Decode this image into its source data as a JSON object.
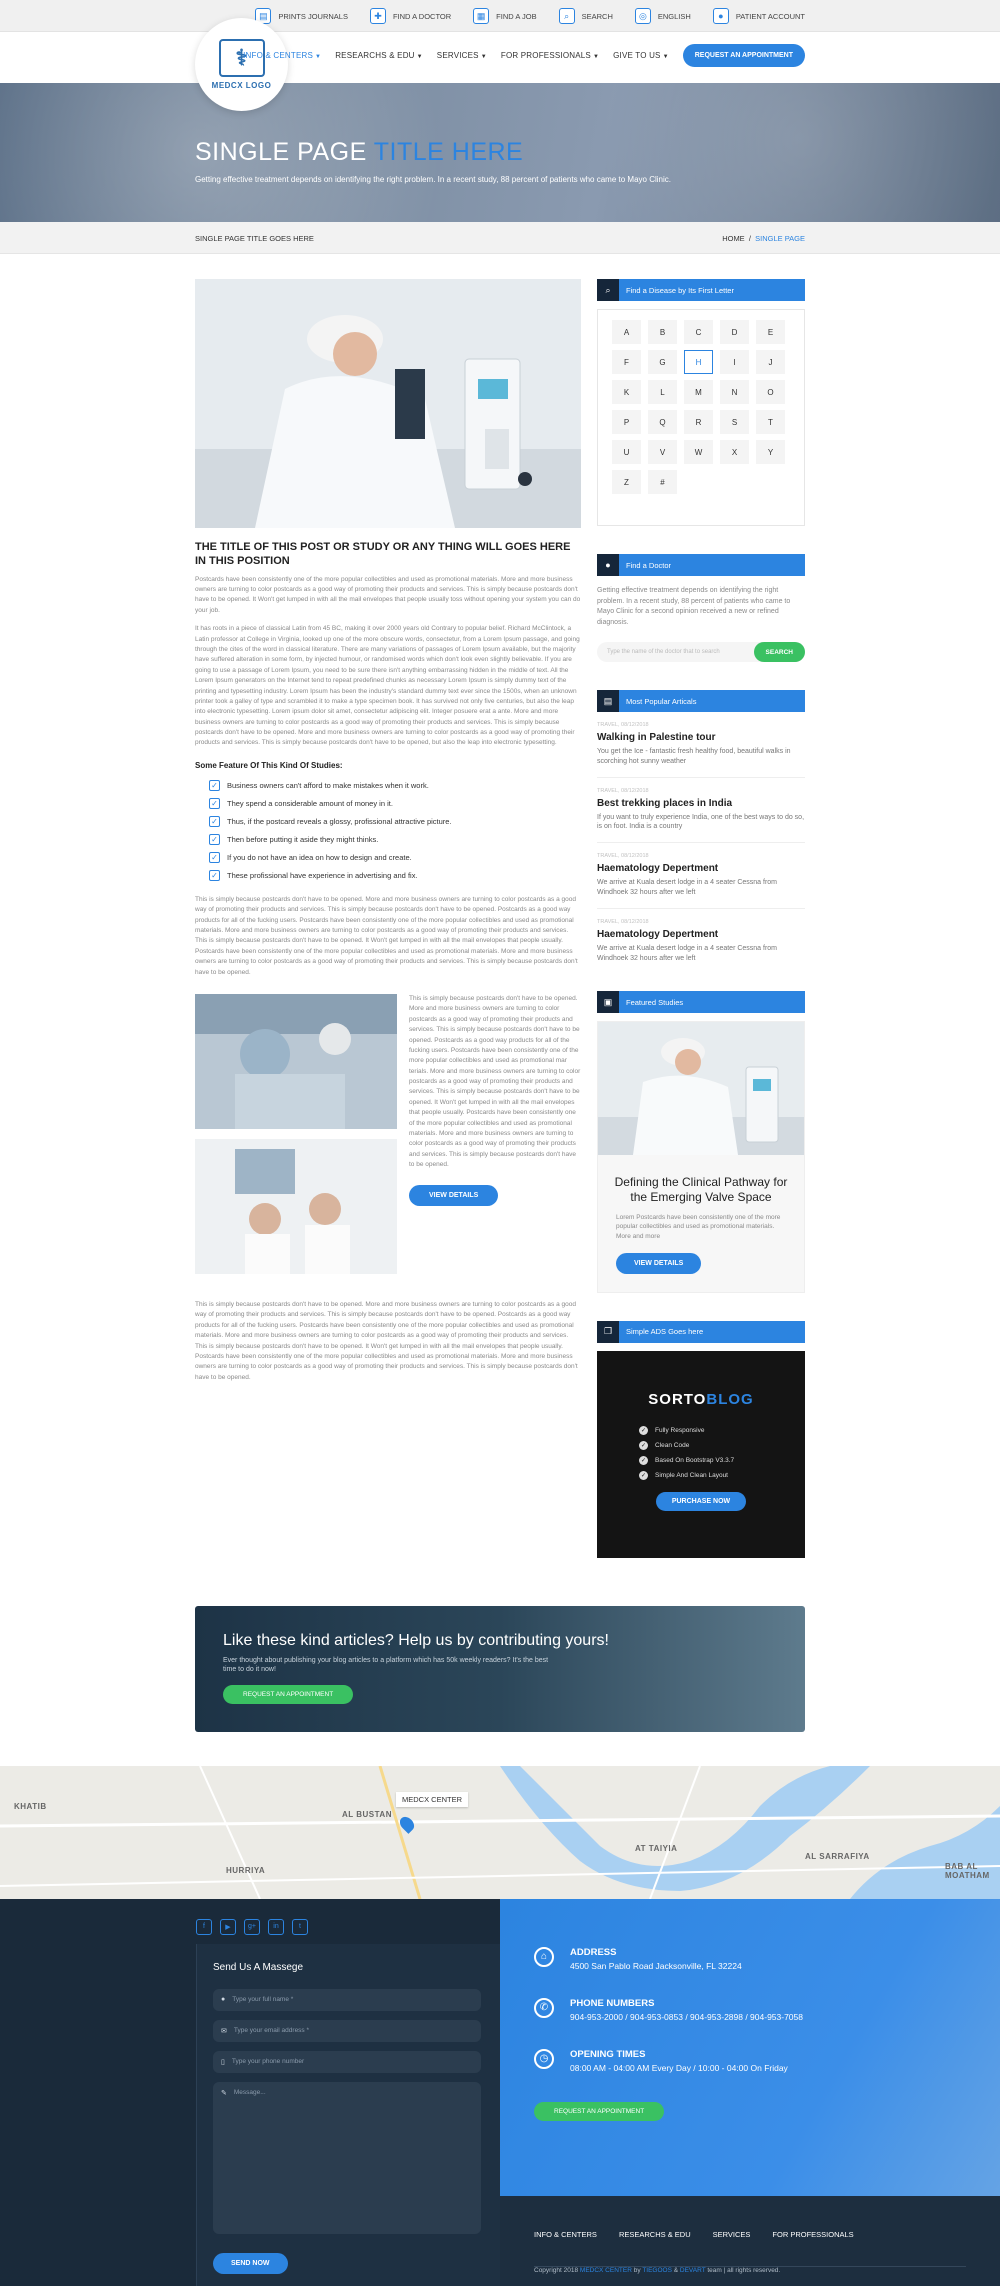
{
  "topbar": {
    "items": [
      {
        "label": "PRINTS JOURNALS",
        "icon": "journal-icon"
      },
      {
        "label": "FIND A DOCTOR",
        "icon": "doctor-icon"
      },
      {
        "label": "FIND A JOB",
        "icon": "job-icon"
      },
      {
        "label": "SEARCH",
        "icon": "search-icon"
      },
      {
        "label": "ENGLISH",
        "icon": "globe-icon"
      },
      {
        "label": "PATIENT ACCOUNT",
        "icon": "user-icon"
      }
    ]
  },
  "logo": {
    "text": "MEDCX LOGO"
  },
  "nav": {
    "items": [
      "INFO & CENTERS",
      "RESEARCHS & EDU",
      "SERVICES",
      "FOR PROFESSIONALS",
      "GIVE TO US"
    ],
    "cta": "REQUEST AN APPOINTMENT"
  },
  "hero": {
    "title_a": "SINGLE PAGE",
    "title_b": "TITLE HERE",
    "subtitle": "Getting effective treatment depends on identifying the right problem. In a recent study, 88 percent of patients who came to Mayo Clinic."
  },
  "crumb": {
    "page": "SINGLE PAGE TITLE GOES HERE",
    "home": "HOME",
    "current": "SINGLE PAGE"
  },
  "post": {
    "title": "THE TITLE OF THIS POST OR STUDY OR ANY THING WILL GOES HERE IN THIS POSITION",
    "p1": "Postcards have been consistently one of the more popular collectibles and used as promotional materials. More and more business owners are turning to color postcards as a good way of promoting their products and services. This is simply because postcards don't have to be opened. It Won't get lumped in with all the mail envelopes that people usually toss without opening your system you can do your job.",
    "p2": "It has roots in a piece of classical Latin from 45 BC, making it over 2000 years old Contrary to popular belief. Richard McClintock, a Latin professor at College in Virginia, looked up one of the more obscure words, consectetur, from a Lorem Ipsum passage, and going through the cites of the word in classical literature. There are many variations of passages of Lorem Ipsum available, but the majority have suffered alteration in some form, by injected humour, or randomised words which don't look even slightly believable. If you are going to use a passage of Lorem Ipsum, you need to be sure there isn't anything embarrassing hidden in the middle of text. All the Lorem Ipsum generators on the Internet tend to repeat predefined chunks as necessary Lorem Ipsum is simply dummy text of the printing and typesetting industry. Lorem Ipsum has been the industry's standard dummy text ever since the 1500s, when an unknown printer took a galley of type and scrambled it to make a type specimen book. It has survived not only five centuries, but also the leap into electronic typesetting. Lorem ipsum dolor sit amet, consectetur adipiscing elit. Integer posuere erat a ante. More and more business owners are turning to color postcards as a good way of promoting their products and services. This is simply because postcards don't have to be opened. More and more business owners are turning to color postcards as a good way of promoting their products and services. This is simply because postcards don't have to be opened, but also the leap into electronic typesetting.",
    "features_title": "Some Feature Of This Kind Of Studies:",
    "features": [
      "Business owners can't afford to make mistakes when it work.",
      "They spend a considerable amount of money in it.",
      "Thus, if the postcard reveals a glossy, profissional attractive picture.",
      "Then before putting it aside they might thinks.",
      "If you do not have an idea on how to design and create.",
      "These profissional have experience in advertising and fix."
    ],
    "p3": "This is simply because postcards don't have to be opened. More and more business owners are turning to color postcards as a good way of promoting their products and services. This is simply because postcards don't have to be opened. Postcards as a good way products for all of the fucking users. Postcards have been consistently one of the more popular collectibles and used as promotional materials. More and more business owners are turning to color postcards as a good way of promoting their products and services. This is simply because postcards don't have to be opened. It Won't get lumped in with all the mail envelopes that people usually. Postcards have been consistently one of the more popular collectibles and used as promotional materials. More and more business owners are turning to color postcards as a good way of promoting their products and services. This is simply because postcards don't have to be opened.",
    "side_text": "This is simply because postcards don't have to be opened. More and more business owners are turning to color postcards as a good way of promoting their products and services. This is simply because postcards don't have to be opened. Postcards as a good way products for all of the fucking users. Postcards have been consistently one of the more popular collectibles and used as promotional mar terials. More and more business owners are turning to color postcards as a good way of promoting their products and services. This is simply because postcards don't have to be opened. It Won't get lumped in with all the mail envelopes that people usually. Postcards have been consistently one of the more popular collectibles and used as promotional materials. More and more business owners are turning to color postcards as a good way of promoting their products and services. This is simply because postcards don't have to be opened.",
    "view_details": "VIEW DETAILS",
    "p4": "This is simply because postcards don't have to be opened. More and more business owners are turning to color postcards as a good way of promoting their products and services. This is simply because postcards don't have to be opened. Postcards as a good way products for all of the fucking users. Postcards have been consistently one of the more popular collectibles and used as promotional materials. More and more business owners are turning to color postcards as a good way of promoting their products and services. This is simply because postcards don't have to be opened. It Won't get lumped in with all the mail envelopes that people usually. Postcards have been consistently one of the more popular collectibles and used as promotional materials. More and more business owners are turning to color postcards as a good way of promoting their products and services. This is simply because postcards don't have to be opened."
  },
  "cta": {
    "title": "Like these kind articles? Help us by contributing yours!",
    "text": "Ever thought about publishing your blog articles to a platform which has 50k weekly readers? It's the best time to do it now!",
    "button": "REQUEST AN APPOINTMENT"
  },
  "sidebar": {
    "disease": {
      "title": "Find a Disease by Its First Letter",
      "letters": [
        "A",
        "B",
        "C",
        "D",
        "E",
        "F",
        "G",
        "H",
        "I",
        "J",
        "K",
        "L",
        "M",
        "N",
        "O",
        "P",
        "Q",
        "R",
        "S",
        "T",
        "U",
        "V",
        "W",
        "X",
        "Y",
        "Z",
        "#"
      ],
      "selected": "H"
    },
    "doctor": {
      "title": "Find a Doctor",
      "text": "Getting effective treatment depends on identifying the right problem. In a recent study, 88 percent of patients who came to Mayo Clinic for a second opinion received a new or refined diagnosis.",
      "placeholder": "Type the name of the doctor that to search",
      "button": "SEARCH"
    },
    "popular": {
      "title": "Most Popular Articals",
      "items": [
        {
          "date": "TRAVEL, 08/12/2018",
          "title": "Walking in Palestine tour",
          "text": "You get the Ice - fantastic fresh healthy food, beautiful walks in scorching hot sunny weather"
        },
        {
          "date": "TRAVEL, 08/12/2018",
          "title": "Best trekking places in India",
          "text": "If you want to truly experience India, one of the best ways to do so, is on foot. India is a country"
        },
        {
          "date": "TRAVEL, 08/12/2018",
          "title": "Haematology Depertment",
          "text": "We arrive at Kuala desert lodge in a 4 seater Cessna from Windhoek 32 hours after we left"
        },
        {
          "date": "TRAVEL, 08/12/2018",
          "title": "Haematology Depertment",
          "text": "We arrive at Kuala desert lodge in a 4 seater Cessna from Windhoek 32 hours after we left"
        }
      ]
    },
    "featured": {
      "title": "Featured Studies",
      "heading": "Defining the Clinical Pathway for the Emerging Valve Space",
      "text": "Lorem Postcards have been consistently one of the more popular collectibles and used as promotional materials. More and more",
      "button": "VIEW DETAILS"
    },
    "ads": {
      "title": "Simple ADS Goes here",
      "brand_a": "SORTO",
      "brand_b": "BLOG",
      "features": [
        "Fully Responsive",
        "Clean Code",
        "Based On Bootstrap V3.3.7",
        "Simple And Clean Layout"
      ],
      "button": "PURCHASE NOW"
    }
  },
  "map": {
    "label": "MEDCX CENTER",
    "places": [
      "KHATIB",
      "AL BUSTAN",
      "HURRIYA",
      "AT TAIYIA",
      "AL SARRAFIYA",
      "BAB AL MOATHAM"
    ]
  },
  "footer": {
    "form": {
      "title": "Send Us A Massege",
      "name": "Type your full name *",
      "email": "Type your email address *",
      "phone": "Type your phone number",
      "message": "Message...",
      "button": "SEND NOW"
    },
    "address_label": "ADDRESS",
    "address": "4500 San Pablo Road Jacksonville, FL 32224",
    "phone_label": "PHONE NUMBERS",
    "phones": "904-953-2000 / 904-953-0853 / 904-953-2898 / 904-953-7058",
    "hours_label": "OPENING TIMES",
    "hours": "08:00 AM - 04:00 AM Every Day / 10:00 - 04:00 On Friday",
    "cta": "REQUEST AN APPOINTMENT",
    "links": [
      "INFO & CENTERS",
      "RESEARCHS & EDU",
      "SERVICES",
      "FOR PROFESSIONALS"
    ],
    "copy_a": "Copyright 2018",
    "copy_brand": "MEDCX CENTER",
    "copy_by": "by",
    "copy_t1": "TIEGOOS",
    "copy_amp": "&",
    "copy_t2": "DEVART",
    "copy_end": "team | all rights reserved."
  }
}
